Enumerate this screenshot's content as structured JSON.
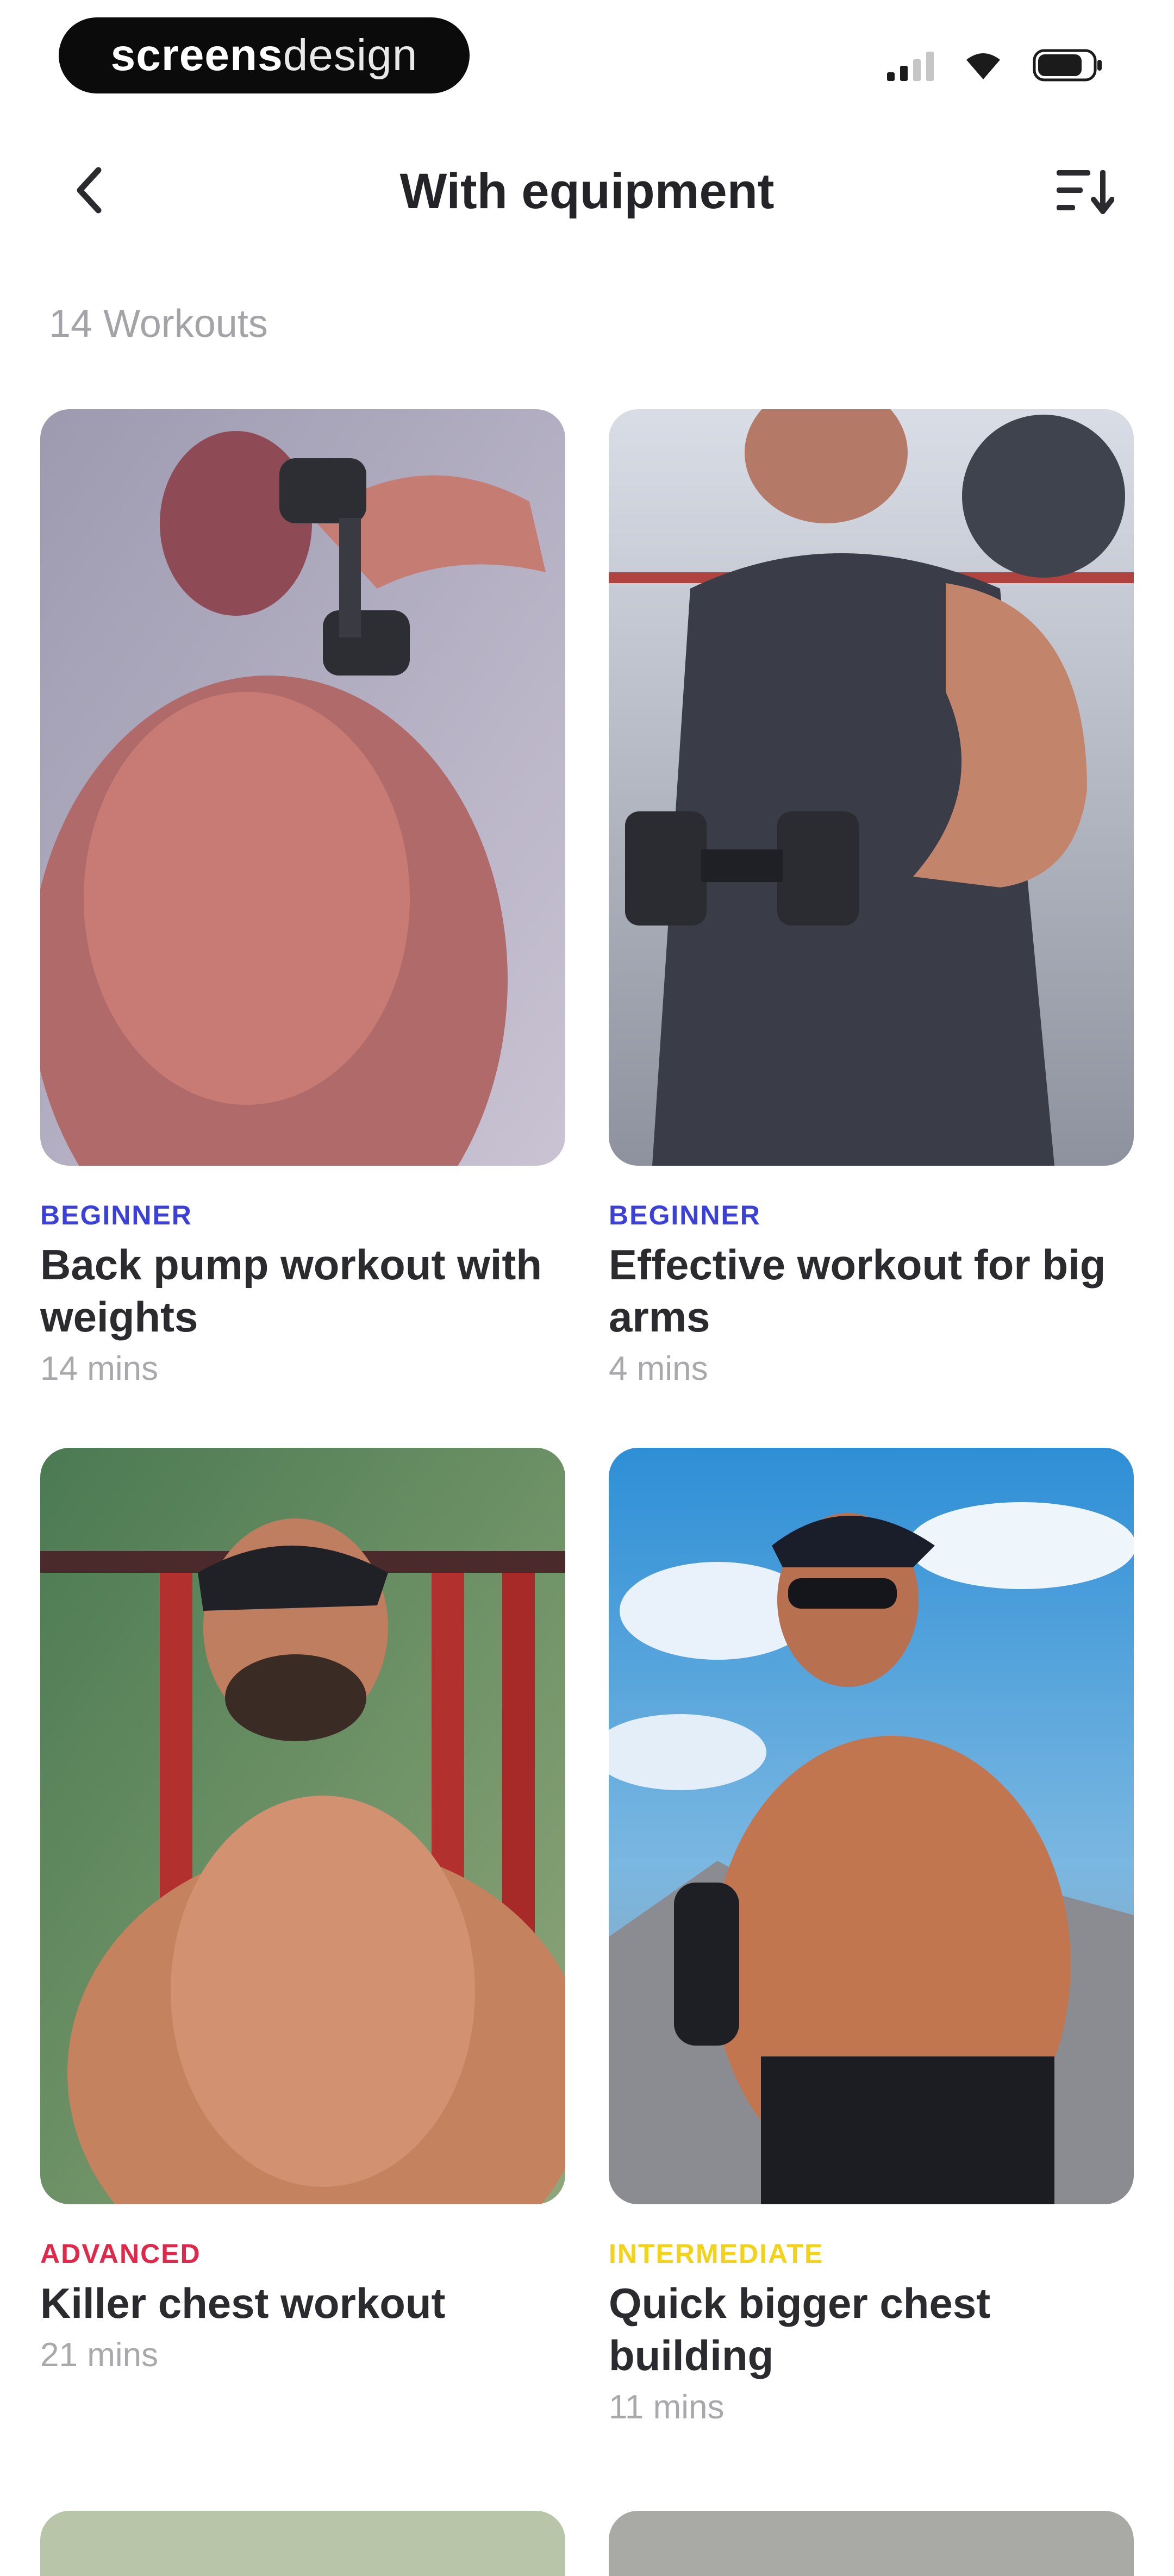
{
  "status_bar": {
    "brand_strong": "screens",
    "brand_light": "design",
    "signal_icon": "signal-icon",
    "wifi_icon": "wifi-icon",
    "battery_icon": "battery-icon"
  },
  "nav": {
    "back_icon": "chevron-left-icon",
    "title": "With equipment",
    "sort_icon": "sort-list-icon"
  },
  "count_label": "14 Workouts",
  "colors": {
    "beginner": "#3b40d8",
    "advanced": "#e0294a",
    "intermediate": "#f2d21a"
  },
  "workouts": [
    {
      "level": "BEGINNER",
      "title": "Back pump workout with weights",
      "duration": "14 mins"
    },
    {
      "level": "BEGINNER",
      "title": "Effective workout for big arms",
      "duration": "4 mins"
    },
    {
      "level": "ADVANCED",
      "title": "Killer chest workout",
      "duration": "21 mins"
    },
    {
      "level": "INTERMEDIATE",
      "title": "Quick bigger chest building",
      "duration": "11 mins"
    }
  ]
}
